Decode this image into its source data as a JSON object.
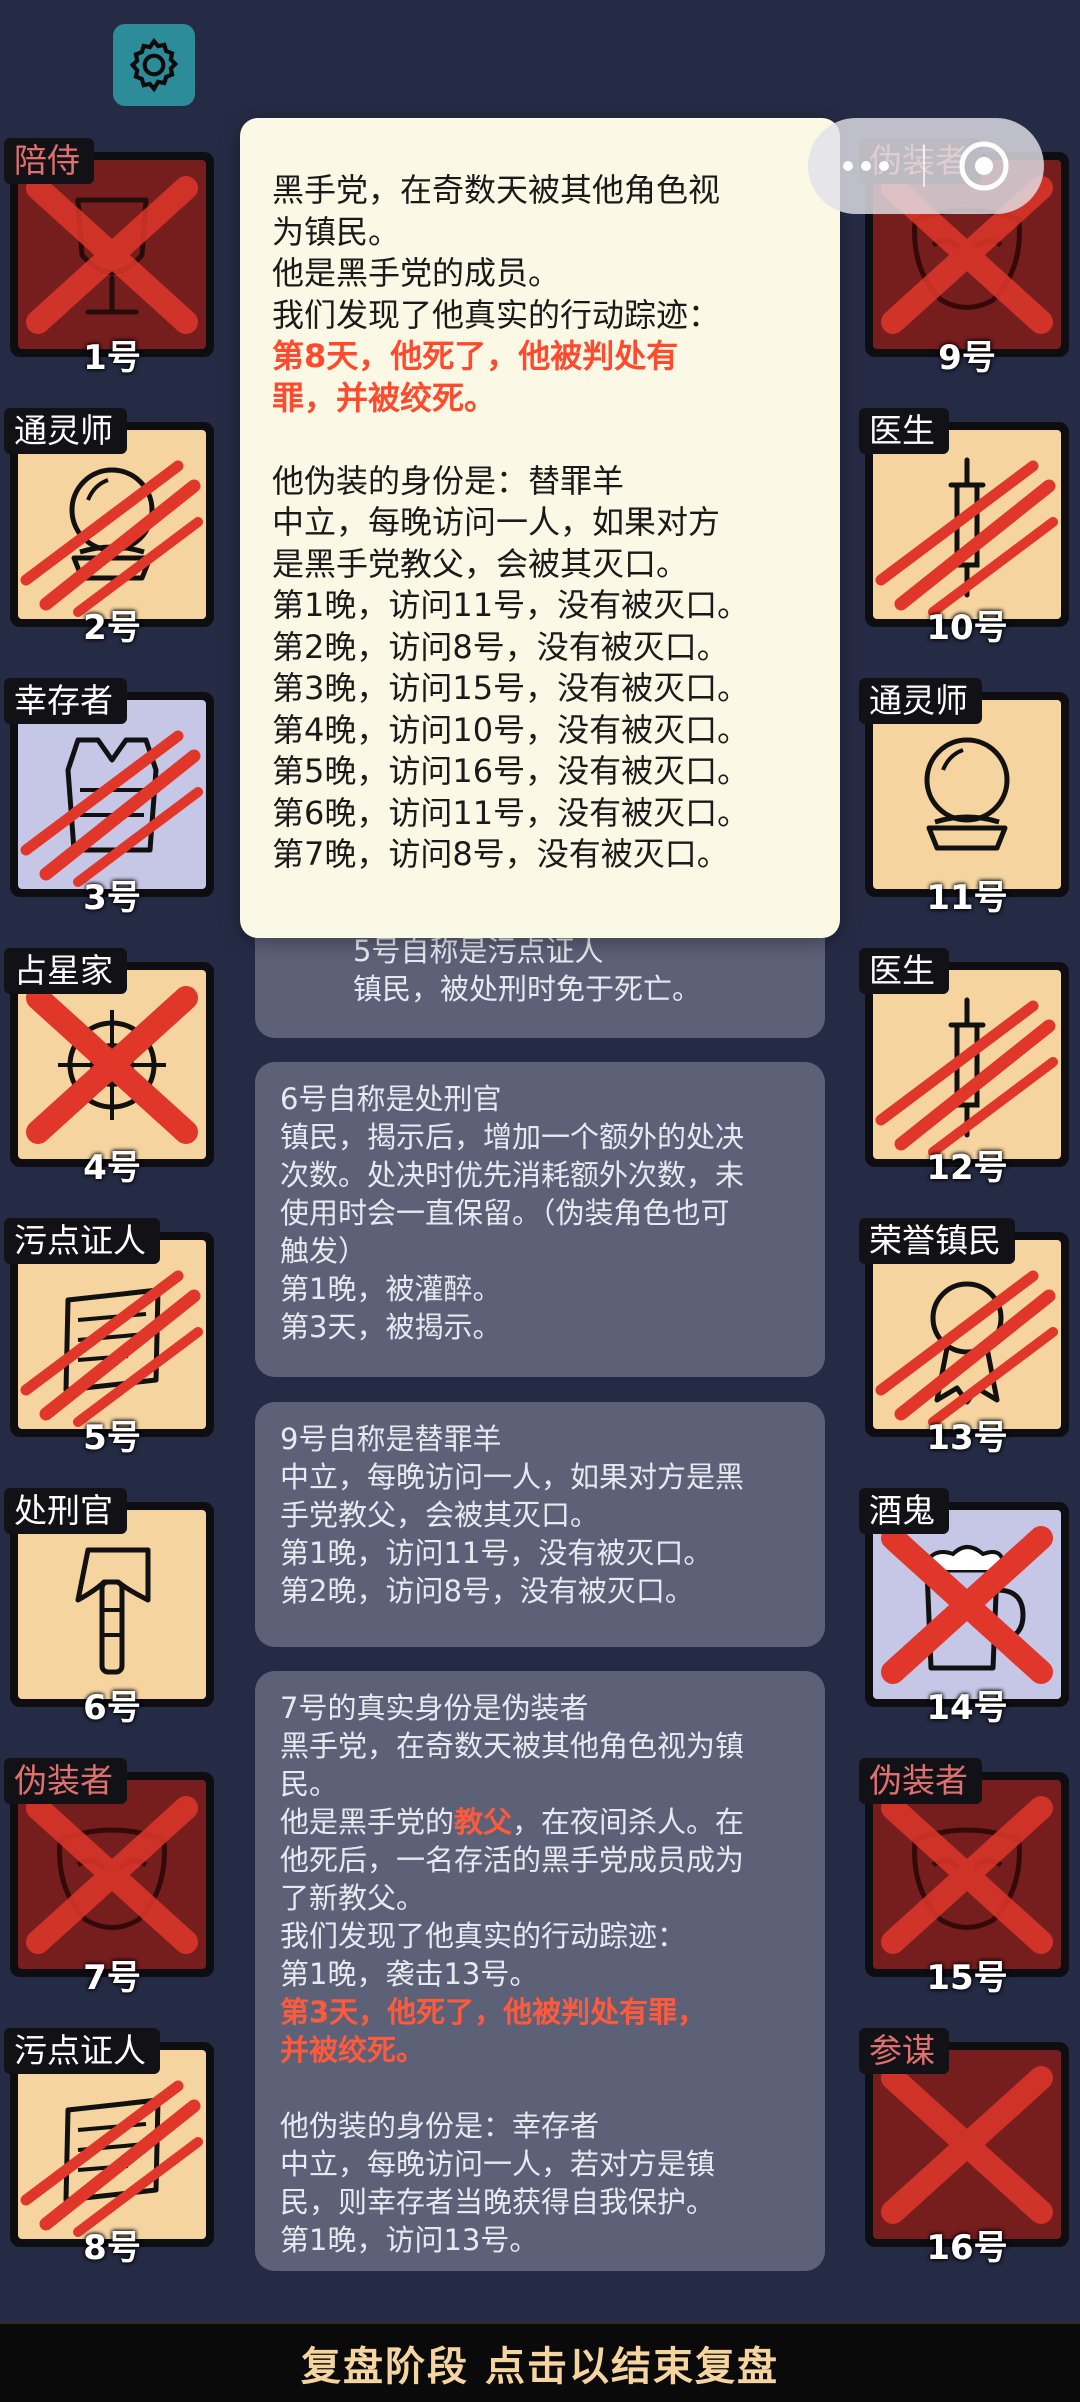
{
  "players": [
    {
      "num": "1号",
      "label": "陪侍",
      "team": "mafia",
      "state": "cross",
      "icon": "glass"
    },
    {
      "num": "2号",
      "label": "通灵师",
      "team": "town",
      "state": "slash",
      "icon": "orb"
    },
    {
      "num": "3号",
      "label": "幸存者",
      "team": "neutral",
      "state": "slash",
      "icon": "vest"
    },
    {
      "num": "4号",
      "label": "占星家",
      "team": "town",
      "state": "cross",
      "icon": "astrolabe"
    },
    {
      "num": "5号",
      "label": "污点证人",
      "team": "town",
      "state": "slash",
      "icon": "scroll"
    },
    {
      "num": "6号",
      "label": "处刑官",
      "team": "town",
      "state": "alive",
      "icon": "axe"
    },
    {
      "num": "7号",
      "label": "伪装者",
      "team": "mafia",
      "state": "cross",
      "icon": "mask"
    },
    {
      "num": "8号",
      "label": "污点证人",
      "team": "town",
      "state": "slash",
      "icon": "scroll"
    },
    {
      "num": "9号",
      "label": "伪装者",
      "team": "mafia",
      "state": "cross",
      "icon": "mask"
    },
    {
      "num": "10号",
      "label": "医生",
      "team": "town",
      "state": "slash",
      "icon": "syringe"
    },
    {
      "num": "11号",
      "label": "通灵师",
      "team": "town",
      "state": "alive",
      "icon": "orb"
    },
    {
      "num": "12号",
      "label": "医生",
      "team": "town",
      "state": "slash",
      "icon": "syringe"
    },
    {
      "num": "13号",
      "label": "荣誉镇民",
      "team": "town",
      "state": "slash",
      "icon": "medal"
    },
    {
      "num": "14号",
      "label": "酒鬼",
      "team": "neutral",
      "state": "cross",
      "icon": "beer"
    },
    {
      "num": "15号",
      "label": "伪装者",
      "team": "mafia",
      "state": "cross",
      "icon": "mask"
    },
    {
      "num": "16号",
      "label": "参谋",
      "team": "mafia",
      "state": "cross",
      "icon": "none"
    }
  ],
  "popup": {
    "lines": [
      {
        "text": "黑手党，在奇数天被其他角色视",
        "style": "normal"
      },
      {
        "text": "为镇民。",
        "style": "normal"
      },
      {
        "text": "他是黑手党的成员。",
        "style": "normal"
      },
      {
        "text": "我们发现了他真实的行动踪迹：",
        "style": "normal"
      },
      {
        "text": "第8天，他死了，他被判处有",
        "style": "red"
      },
      {
        "text": "罪，并被绞死。",
        "style": "red"
      },
      {
        "text": "",
        "style": "blank"
      },
      {
        "text": "他伪装的身份是：替罪羊",
        "style": "normal"
      },
      {
        "text": "中立，每晚访问一人，如果对方",
        "style": "normal"
      },
      {
        "text": "是黑手党教父，会被其灭口。",
        "style": "normal"
      },
      {
        "text": "第1晚，访问11号，没有被灭口。",
        "style": "normal"
      },
      {
        "text": "第2晚，访问8号，没有被灭口。",
        "style": "normal"
      },
      {
        "text": "第3晚，访问15号，没有被灭口。",
        "style": "normal"
      },
      {
        "text": "第4晚，访问10号，没有被灭口。",
        "style": "normal"
      },
      {
        "text": "第5晚，访问16号，没有被灭口。",
        "style": "normal"
      },
      {
        "text": "第6晚，访问11号，没有被灭口。",
        "style": "normal"
      },
      {
        "text": "第7晚，访问8号，没有被灭口。",
        "style": "normal"
      }
    ]
  },
  "logs": [
    {
      "lines": [
        {
          "text": "5号自称是污点证人"
        },
        {
          "text": "镇民，被处刑时免于死亡。"
        }
      ]
    },
    {
      "lines": [
        {
          "text": "6号自称是处刑官"
        },
        {
          "text": "镇民，揭示后，增加一个额外的处决"
        },
        {
          "text": "次数。处决时优先消耗额外次数，未"
        },
        {
          "text": "使用时会一直保留。（伪装角色也可"
        },
        {
          "text": "触发）"
        },
        {
          "text": "第1晚，被灌醉。"
        },
        {
          "text": "第3天，被揭示。"
        }
      ]
    },
    {
      "lines": [
        {
          "text": "9号自称是替罪羊"
        },
        {
          "text": "中立，每晚访问一人，如果对方是黑"
        },
        {
          "text": "手党教父，会被其灭口。"
        },
        {
          "text": "第1晚，访问11号，没有被灭口。"
        },
        {
          "text": "第2晚，访问8号，没有被灭口。"
        }
      ]
    },
    {
      "lines": [
        {
          "text": "7号的真实身份是伪装者"
        },
        {
          "text": "黑手党，在奇数天被其他角色视为镇"
        },
        {
          "text": "民。"
        },
        {
          "pre": "他是黑手党的",
          "hl": "教父",
          "post": "，在夜间杀人。在"
        },
        {
          "text": "他死后，一名存活的黑手党成员成为"
        },
        {
          "text": "了新教父。"
        },
        {
          "text": "我们发现了他真实的行动踪迹："
        },
        {
          "text": "第1晚，袭击13号。"
        },
        {
          "text": "第3天，他死了，他被判处有罪，",
          "red": true
        },
        {
          "text": "并被绞死。",
          "red": true
        },
        {
          "text": ""
        },
        {
          "text": "他伪装的身份是：幸存者"
        },
        {
          "text": "中立，每晚访问一人，若对方是镇"
        },
        {
          "text": "民，则幸存者当晚获得自我保护。"
        },
        {
          "text": "第1晚，访问13号。"
        }
      ]
    }
  ],
  "bottom_bar": {
    "label": "复盘阶段 点击以结束复盘"
  },
  "colors": {
    "background": "#262b45",
    "town": "#f5d49f",
    "neutral": "#c6c6e6",
    "mafia": "#761d1e",
    "dead_mark": "#e0372a",
    "highlight": "#ff4a2e",
    "bottom_text": "#f5d49f"
  }
}
